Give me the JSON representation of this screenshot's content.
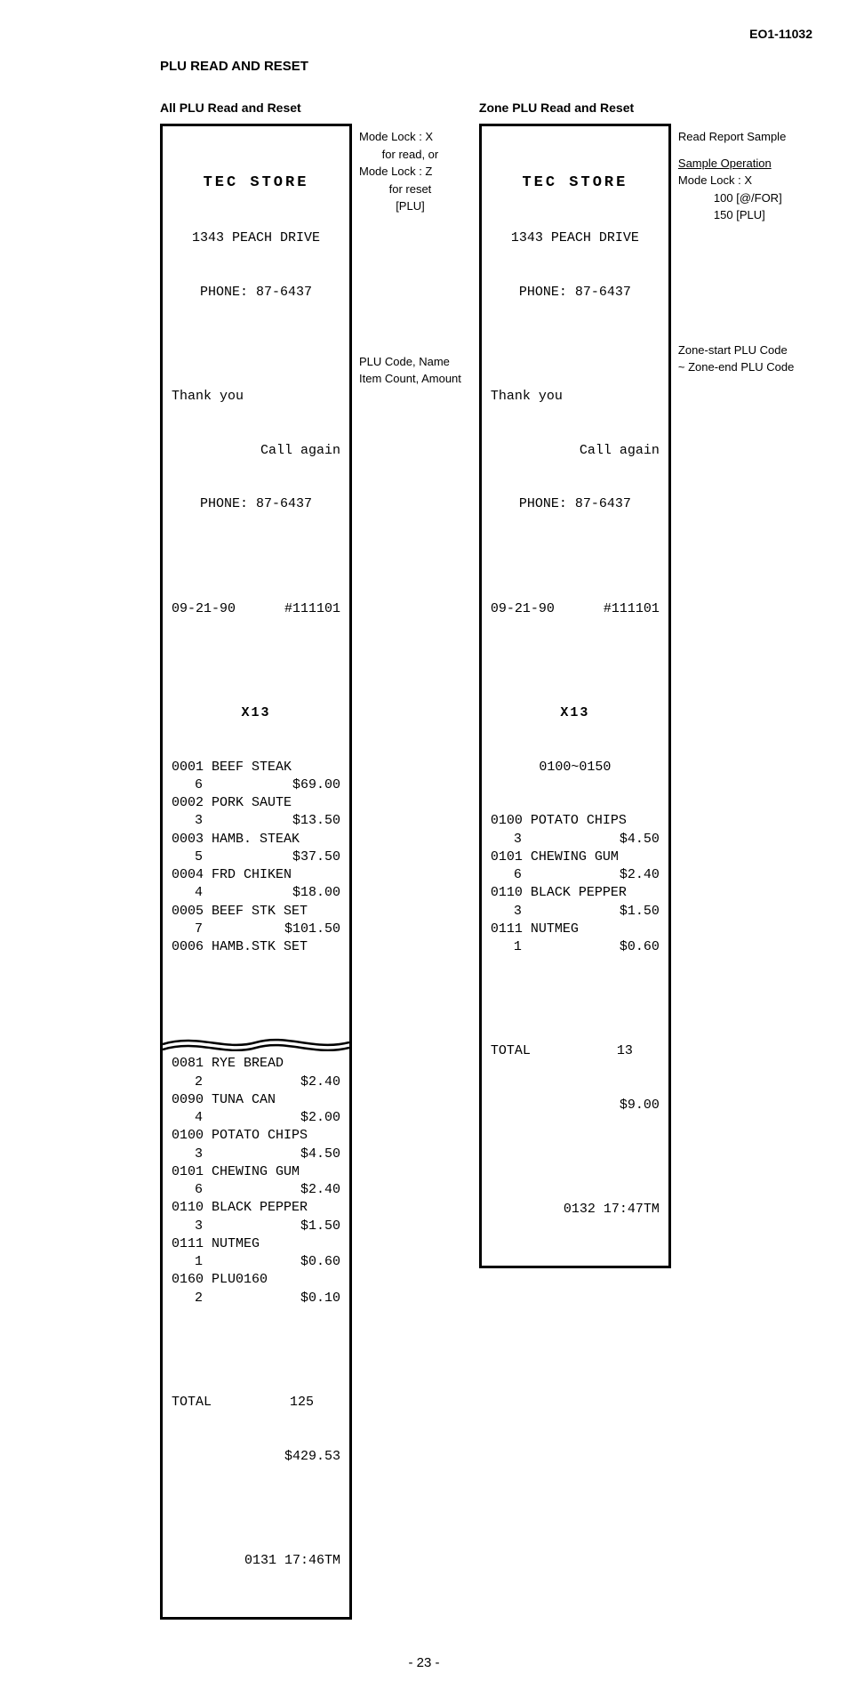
{
  "doc_id": "EO1-11032",
  "main_heading": "PLU READ AND RESET",
  "page_number": "- 23 -",
  "left": {
    "heading": "All PLU Read and Reset",
    "receipt": {
      "store_name": "TEC STORE",
      "address": "1343 PEACH DRIVE",
      "phone": "PHONE: 87-6437",
      "thank": "Thank you",
      "call": "Call again",
      "phone2": "PHONE: 87-6437",
      "date": "09-21-90",
      "id": "#111101",
      "x13": "X13",
      "items_top": [
        {
          "code": "0001",
          "name": "BEEF STEAK",
          "count": "6",
          "amount": "$69.00"
        },
        {
          "code": "0002",
          "name": "PORK SAUTE",
          "count": "3",
          "amount": "$13.50"
        },
        {
          "code": "0003",
          "name": "HAMB. STEAK",
          "count": "5",
          "amount": "$37.50"
        },
        {
          "code": "0004",
          "name": "FRD CHIKEN",
          "count": "4",
          "amount": "$18.00"
        },
        {
          "code": "0005",
          "name": "BEEF STK SET",
          "count": "7",
          "amount": "$101.50"
        },
        {
          "code": "0006",
          "name": "HAMB.STK SET",
          "count": "",
          "amount": ""
        }
      ],
      "items_bottom": [
        {
          "code": "0081",
          "name": "RYE BREAD",
          "count": "2",
          "amount": "$2.40"
        },
        {
          "code": "0090",
          "name": "TUNA CAN",
          "count": "4",
          "amount": "$2.00"
        },
        {
          "code": "0100",
          "name": "POTATO CHIPS",
          "count": "3",
          "amount": "$4.50"
        },
        {
          "code": "0101",
          "name": "CHEWING GUM",
          "count": "6",
          "amount": "$2.40"
        },
        {
          "code": "0110",
          "name": "BLACK PEPPER",
          "count": "3",
          "amount": "$1.50"
        },
        {
          "code": "0111",
          "name": "NUTMEG",
          "count": "1",
          "amount": "$0.60"
        },
        {
          "code": "0160",
          "name": "PLU0160",
          "count": "2",
          "amount": "$0.10"
        }
      ],
      "total_label": "TOTAL",
      "total_count": "125",
      "total_amount": "$429.53",
      "footer": "0131 17:46TM"
    },
    "notes": {
      "n1": "Mode Lock : X",
      "n2": "for read, or",
      "n3": "Mode Lock : Z",
      "n4": "for reset",
      "n5": "[PLU]",
      "n6": "PLU Code, Name",
      "n7": "Item Count, Amount"
    }
  },
  "right": {
    "heading": "Zone PLU Read and Reset",
    "receipt": {
      "store_name": "TEC STORE",
      "address": "1343 PEACH DRIVE",
      "phone": "PHONE: 87-6437",
      "thank": "Thank you",
      "call": "Call again",
      "phone2": "PHONE: 87-6437",
      "date": "09-21-90",
      "id": "#111101",
      "x13": "X13",
      "zone": "0100~0150",
      "items": [
        {
          "code": "0100",
          "name": "POTATO CHIPS",
          "count": "3",
          "amount": "$4.50"
        },
        {
          "code": "0101",
          "name": "CHEWING GUM",
          "count": "6",
          "amount": "$2.40"
        },
        {
          "code": "0110",
          "name": "BLACK PEPPER",
          "count": "3",
          "amount": "$1.50"
        },
        {
          "code": "0111",
          "name": "NUTMEG",
          "count": "1",
          "amount": "$0.60"
        }
      ],
      "total_label": "TOTAL",
      "total_count": "13",
      "total_amount": "$9.00",
      "footer": "0132 17:47TM"
    },
    "notes": {
      "n1": "Read Report Sample",
      "n2": "Sample Operation",
      "n3": "Mode Lock : X",
      "n4": "100 [@/FOR]",
      "n5": "150 [PLU]",
      "n6": "Zone-start PLU Code",
      "n7": "~ Zone-end PLU Code"
    }
  }
}
